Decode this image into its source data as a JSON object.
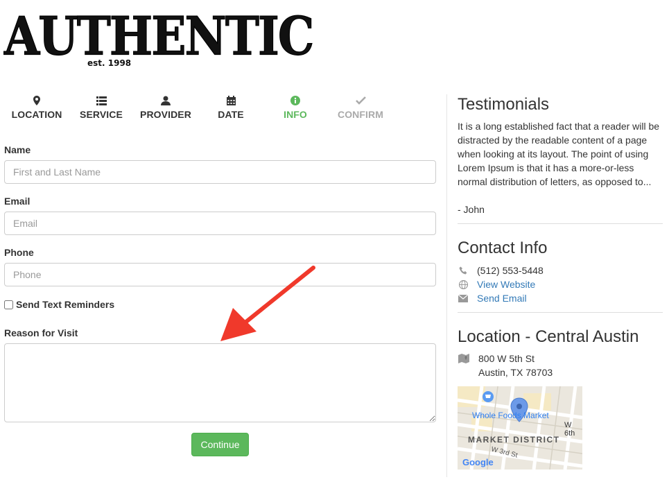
{
  "logo": {
    "word": "Authentic",
    "est": "est. 1998"
  },
  "steps": [
    {
      "label": "LOCATION",
      "icon": "map-marker-icon",
      "state": "done"
    },
    {
      "label": "SERVICE",
      "icon": "list-icon",
      "state": "done"
    },
    {
      "label": "PROVIDER",
      "icon": "user-icon",
      "state": "done"
    },
    {
      "label": "DATE",
      "icon": "calendar-icon",
      "state": "done"
    },
    {
      "label": "INFO",
      "icon": "info-circle-icon",
      "state": "active"
    },
    {
      "label": "CONFIRM",
      "icon": "check-icon",
      "state": "disabled"
    }
  ],
  "form": {
    "name_label": "Name",
    "name_placeholder": "First and Last Name",
    "email_label": "Email",
    "email_placeholder": "Email",
    "phone_label": "Phone",
    "phone_placeholder": "Phone",
    "reminders_label": "Send Text Reminders",
    "reminders_checked": false,
    "reason_label": "Reason for Visit",
    "reason_value": "",
    "continue_label": "Continue"
  },
  "sidebar": {
    "testimonials_title": "Testimonials",
    "testimonial_text": "It is a long established fact that a reader will be distracted by the readable content of a page when looking at its layout. The point of using Lorem Ipsum is that it has a more-or-less normal distribution of letters, as opposed to...",
    "testimonial_author": "- John",
    "contact_title": "Contact Info",
    "phone": "(512) 553-5448",
    "website_link": "View Website",
    "email_link": "Send Email",
    "location_title": "Location - Central Austin",
    "address_line1": "800 W 5th St",
    "address_line2": "Austin, TX 78703"
  },
  "map": {
    "poi_label": "Whole Foods Market",
    "district_label": "MARKET DISTRICT",
    "street1": "W 6th",
    "street2": "W 3rd St",
    "brand": "Google"
  },
  "colors": {
    "active_green": "#5cb85c",
    "link_blue": "#337ab7",
    "arrow_red": "#f0392b"
  }
}
